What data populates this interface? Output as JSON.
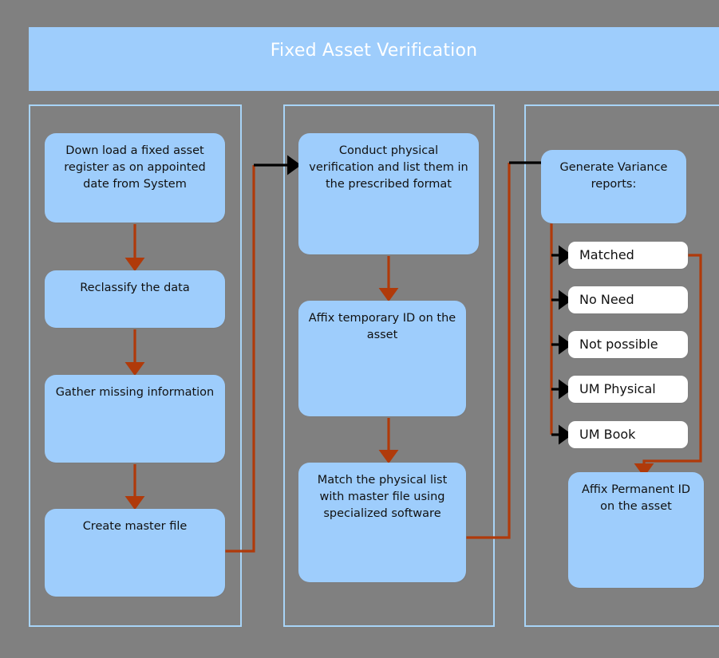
{
  "diagram": {
    "title": "Fixed Asset Verification",
    "background_color": "#808080",
    "node_fill": "#9ecdfc",
    "white_node_fill": "#ffffff",
    "lane_border_color": "#a8d4f7",
    "connector_color": "#b03a0a",
    "arrowhead_black": "#000000",
    "title_text_color": "#ffffff"
  },
  "lanes": [
    {
      "id": "lane-1",
      "name": "column-one"
    },
    {
      "id": "lane-2",
      "name": "column-two"
    },
    {
      "id": "lane-3",
      "name": "column-three"
    }
  ],
  "nodes": {
    "download": "Down load a fixed asset register as on appointed date from System",
    "reclassify": "Reclassify the data",
    "gather": "Gather missing information",
    "master": "Create master file",
    "conduct": "Conduct physical verification and list them in the prescribed format",
    "affix_temp": "Affix temporary ID on the asset",
    "match": "Match the physical list with master file using specialized software",
    "variance": "Generate Variance reports:",
    "matched": "Matched",
    "no_need": "No Need",
    "not_possible": "Not possible",
    "um_physical": "UM Physical",
    "um_book": "UM Book",
    "affix_perm": "Affix Permanent ID on the asset"
  },
  "chart_data": {
    "type": "diagram",
    "title": "Fixed Asset Verification",
    "flow_steps": [
      {
        "lane": 1,
        "order": 1,
        "label": "Down load a fixed asset register as on appointed date from System"
      },
      {
        "lane": 1,
        "order": 2,
        "label": "Reclassify the data"
      },
      {
        "lane": 1,
        "order": 3,
        "label": "Gather missing information"
      },
      {
        "lane": 1,
        "order": 4,
        "label": "Create master file"
      },
      {
        "lane": 2,
        "order": 5,
        "label": "Conduct physical verification and list them in the prescribed format"
      },
      {
        "lane": 2,
        "order": 6,
        "label": "Affix temporary ID on the asset"
      },
      {
        "lane": 2,
        "order": 7,
        "label": "Match the physical list with master file using specialized software"
      },
      {
        "lane": 3,
        "order": 8,
        "label": "Generate Variance reports:"
      },
      {
        "lane": 3,
        "order": 9,
        "label": "Matched"
      },
      {
        "lane": 3,
        "order": 10,
        "label": "No Need"
      },
      {
        "lane": 3,
        "order": 11,
        "label": "Not possible"
      },
      {
        "lane": 3,
        "order": 12,
        "label": "UM Physical"
      },
      {
        "lane": 3,
        "order": 13,
        "label": "UM Book"
      },
      {
        "lane": 3,
        "order": 14,
        "label": "Affix Permanent ID on the asset"
      }
    ],
    "edges": [
      {
        "from": "Down load a fixed asset register as on appointed date from System",
        "to": "Reclassify the data"
      },
      {
        "from": "Reclassify the data",
        "to": "Gather missing information"
      },
      {
        "from": "Gather missing information",
        "to": "Create master file"
      },
      {
        "from": "Create master file",
        "to": "Conduct physical verification and list them in the prescribed format"
      },
      {
        "from": "Conduct physical verification and list them in the prescribed format",
        "to": "Affix temporary ID on the asset"
      },
      {
        "from": "Affix temporary ID on the asset",
        "to": "Match the physical list with master file using specialized software"
      },
      {
        "from": "Match the physical list with master file using specialized software",
        "to": "Generate Variance reports:"
      },
      {
        "from": "Generate Variance reports:",
        "to": "Matched"
      },
      {
        "from": "Generate Variance reports:",
        "to": "No Need"
      },
      {
        "from": "Generate Variance reports:",
        "to": "Not possible"
      },
      {
        "from": "Generate Variance reports:",
        "to": "UM Physical"
      },
      {
        "from": "Generate Variance reports:",
        "to": "UM Book"
      },
      {
        "from": "Matched",
        "to": "Affix Permanent ID on the asset"
      }
    ]
  }
}
